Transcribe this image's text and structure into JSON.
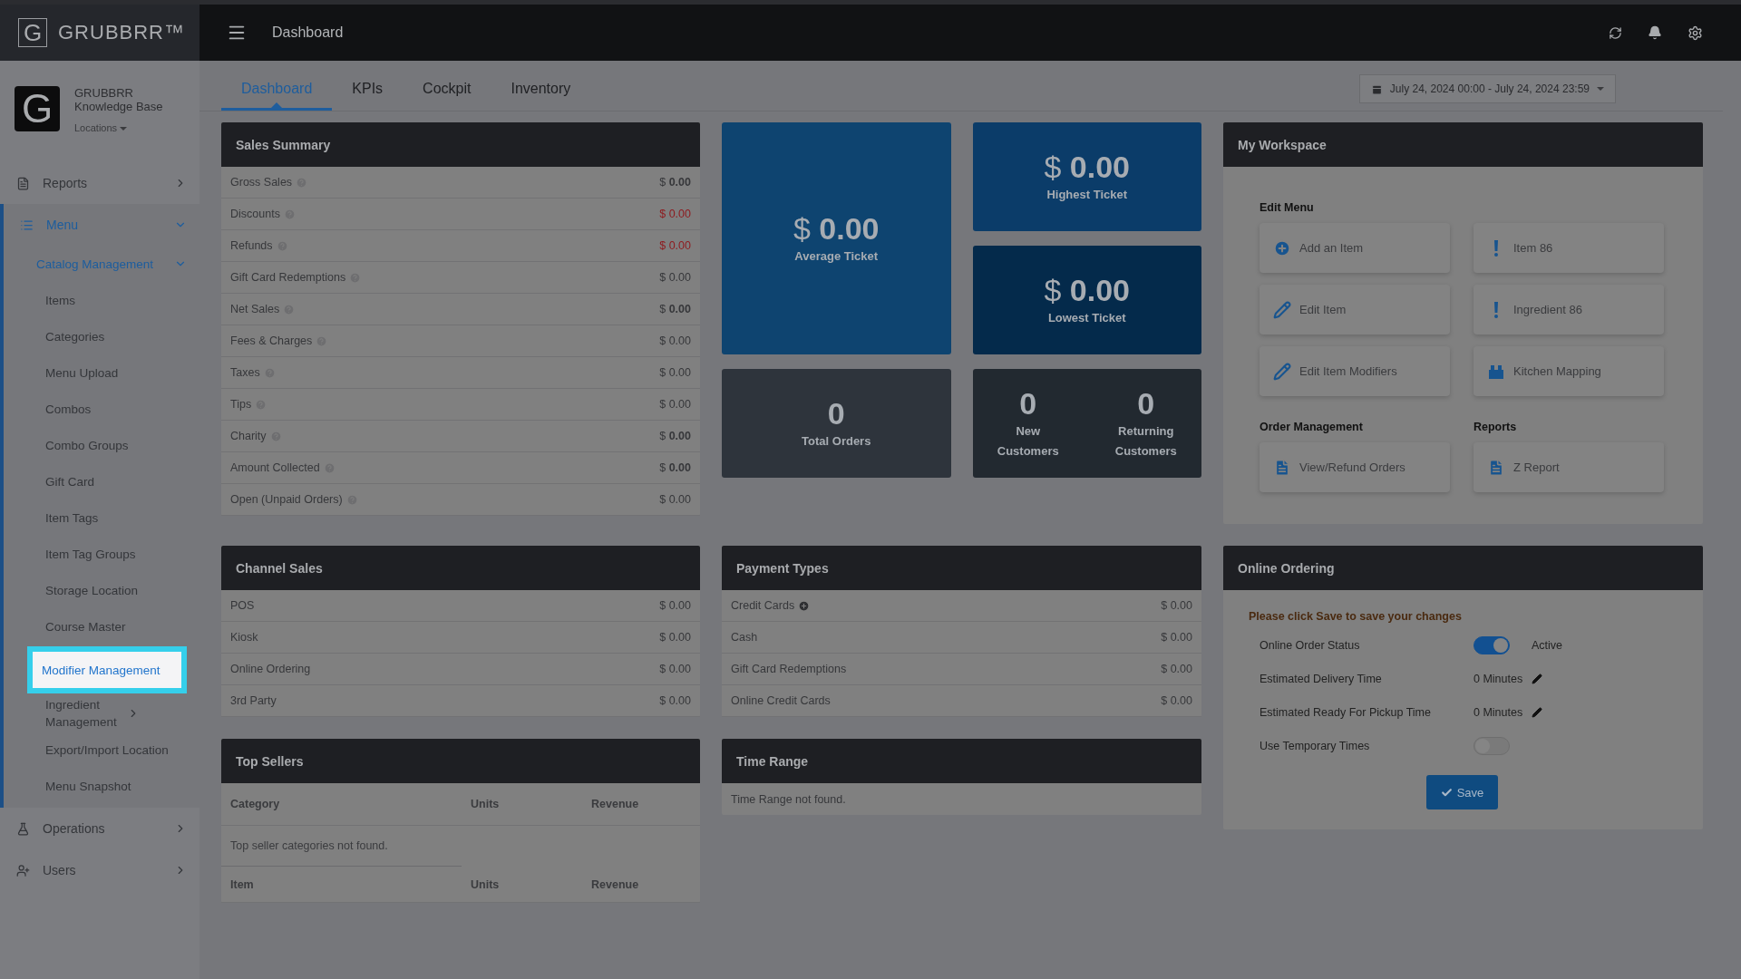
{
  "brand": {
    "logo_letter": "G",
    "name": "GRUBBRR™"
  },
  "topbar": {
    "title": "Dashboard"
  },
  "org": {
    "logo_letter": "G",
    "name": "GRUBBRR",
    "subtitle": "Knowledge Base",
    "locations": "Locations"
  },
  "sidebar": {
    "items": [
      {
        "label": "Reports",
        "expanded": false,
        "selected": false
      },
      {
        "label": "Menu",
        "expanded": true,
        "selected": true,
        "children": [
          {
            "label": "Catalog Management",
            "expanded": true,
            "selected": true,
            "children": [
              {
                "label": "Items",
                "selected": false
              },
              {
                "label": "Categories",
                "selected": false
              },
              {
                "label": "Menu Upload",
                "selected": false
              },
              {
                "label": "Combos",
                "selected": false
              },
              {
                "label": "Combo Groups",
                "selected": false
              },
              {
                "label": "Gift Card",
                "selected": false
              },
              {
                "label": "Item Tags",
                "selected": false
              },
              {
                "label": "Item Tag Groups",
                "selected": false
              },
              {
                "label": "Storage Location",
                "selected": false
              },
              {
                "label": "Course Master",
                "selected": false
              },
              {
                "label": "Modifier Management",
                "selected": true
              },
              {
                "label": "Ingredient Management",
                "selected": false,
                "expanded": false
              },
              {
                "label": "Export/Import Location",
                "selected": false
              },
              {
                "label": "Menu Snapshot",
                "selected": false
              }
            ]
          }
        ]
      },
      {
        "label": "Operations",
        "expanded": false,
        "selected": false
      },
      {
        "label": "Users",
        "expanded": false,
        "selected": false
      }
    ]
  },
  "tabs": [
    {
      "label": "Dashboard",
      "selected": true
    },
    {
      "label": "KPIs",
      "selected": false
    },
    {
      "label": "Cockpit",
      "selected": false
    },
    {
      "label": "Inventory",
      "selected": false
    }
  ],
  "date_range": "July 24, 2024 00:00 - July 24, 2024 23:59",
  "sales_summary": {
    "title": "Sales Summary",
    "rows": [
      {
        "label": "Gross Sales",
        "value": "$ **0.00**",
        "negative": false
      },
      {
        "label": "Discounts",
        "value": "$ 0.00",
        "negative": true
      },
      {
        "label": "Refunds",
        "value": "$ 0.00",
        "negative": true
      },
      {
        "label": "Gift Card Redemptions",
        "value": "$ 0.00",
        "negative": false
      },
      {
        "label": "Net Sales",
        "value": "$ **0.00**",
        "negative": false
      },
      {
        "label": "Fees & Charges",
        "value": "$ 0.00",
        "negative": false
      },
      {
        "label": "Taxes",
        "value": "$ 0.00",
        "negative": false
      },
      {
        "label": "Tips",
        "value": "$ 0.00",
        "negative": false
      },
      {
        "label": "Charity",
        "value": "$ **0.00**",
        "negative": false
      },
      {
        "label": "Amount Collected",
        "value": "$ **0.00**",
        "negative": false
      },
      {
        "label": "Open (Unpaid Orders)",
        "value": "$ 0.00",
        "negative": false
      }
    ]
  },
  "tiles": {
    "average": {
      "value": "$ **0.00**",
      "label": "Average Ticket"
    },
    "highest": {
      "value": "$ **0.00**",
      "label": "Highest Ticket"
    },
    "lowest": {
      "value": "$ **0.00**",
      "label": "Lowest Ticket"
    },
    "total_orders": {
      "value": "0",
      "label": "Total Orders"
    },
    "customers": [
      {
        "value": "0",
        "label": "New Customers"
      },
      {
        "value": "0",
        "label": "Returning Customers"
      }
    ]
  },
  "workspace": {
    "title": "My Workspace",
    "sections": [
      {
        "title": "Edit Menu",
        "buttons": [
          "Add an Item",
          "Item 86",
          "Edit Item",
          "Ingredient 86",
          "Edit Item Modifiers",
          "Kitchen Mapping"
        ]
      },
      {
        "title": "Order Management",
        "buttons": [
          "View/Refund Orders"
        ]
      },
      {
        "title": "Reports",
        "buttons": [
          "Z Report"
        ]
      }
    ]
  },
  "channel_sales": {
    "title": "Channel Sales",
    "rows": [
      {
        "label": "POS",
        "value": "$ 0.00"
      },
      {
        "label": "Kiosk",
        "value": "$ 0.00"
      },
      {
        "label": "Online Ordering",
        "value": "$ 0.00"
      },
      {
        "label": "3rd Party",
        "value": "$ 0.00"
      }
    ]
  },
  "payment_types": {
    "title": "Payment Types",
    "rows": [
      {
        "label": "Credit Cards",
        "value": "$ 0.00",
        "expandable": true
      },
      {
        "label": "Cash",
        "value": "$ 0.00",
        "expandable": false
      },
      {
        "label": "Gift Card Redemptions",
        "value": "$ 0.00",
        "expandable": false
      },
      {
        "label": "Online Credit Cards",
        "value": "$ 0.00",
        "expandable": false
      }
    ]
  },
  "online_ordering": {
    "title": "Online Ordering",
    "notice": "Please click Save to save your changes",
    "rows": [
      {
        "kind": "toggle",
        "label": "Online Order Status",
        "on": true,
        "status": "Active"
      },
      {
        "kind": "time",
        "label": "Estimated Delivery Time",
        "value": "0 Minutes"
      },
      {
        "kind": "time",
        "label": "Estimated Ready For Pickup Time",
        "value": "0 Minutes"
      },
      {
        "kind": "toggle",
        "label": "Use Temporary Times",
        "on": false
      }
    ],
    "save": "Save"
  },
  "top_sellers": {
    "title": "Top Sellers",
    "columns": [
      "Category",
      "Units",
      "Revenue"
    ],
    "empty": "Top seller categories not found.",
    "columns_2": [
      "Item",
      "Units",
      "Revenue"
    ]
  },
  "time_range": {
    "title": "Time Range",
    "empty": "Time Range not found."
  }
}
